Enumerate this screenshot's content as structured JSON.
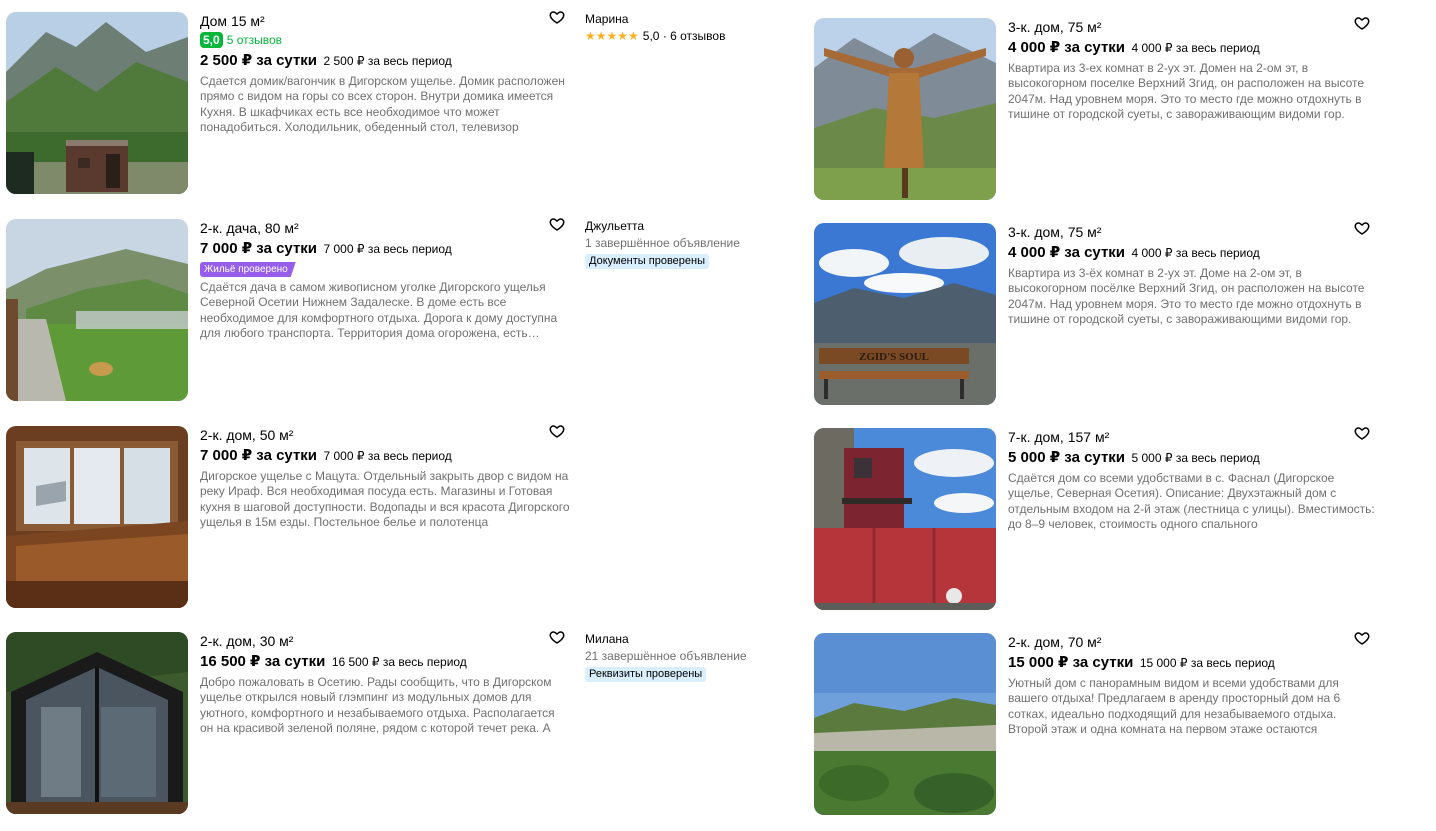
{
  "listings": [
    {
      "title": "Дом 15 м²",
      "rating": "5,0",
      "reviews": "5 отзывов",
      "price_main": "2 500 ₽ за сутки",
      "price_total": "2 500 ₽ за весь период",
      "description": "Сдается домик/вагончик в Дигорском ущелье. Домик расположен прямо с видом на горы со всех сторон. Внутри домика имеется Кухня. В шкафчиках есть все необходимое что может понадобиться. Холодильник, обеденный стол, телевизор",
      "photo": "mountain-valley-cabin"
    },
    {
      "title": "2-к. дача, 80 м²",
      "price_main": "7 000 ₽ за сутки",
      "price_total": "7 000 ₽ за весь период",
      "badge": "Жильё проверено",
      "description": "Сдаётся дача в самом живописном уголке Дигорского ущелья Северной Осетии Нижнем Задалеске. В доме есть все необходимое для комфортного отдыха. Дорога к дому доступна для любого транспорта. Территория дома огорожена, есть парковка",
      "photo": "mountain-garden-path"
    },
    {
      "title": "2-к. дом, 50 м²",
      "price_main": "7 000 ₽ за сутки",
      "price_total": "7 000 ₽ за весь период",
      "description": "Дигорское ущелье с Мацута. Отдельный закрыть двор с видом на реку Ираф. Вся необходимая посуда есть. Магазины и Готовая кухня в шаговой доступности. Водопады и вся красота Дигорского ущелья в 15м езды. Постельное белье и полотенца",
      "photo": "wooden-dining-room"
    },
    {
      "title": "2-к. дом, 30 м²",
      "price_main": "16 500 ₽ за сутки",
      "price_total": "16 500 ₽ за весь период",
      "description": "Добро пожаловать в Осетию. Рады сообщить, что в Дигорском ущелье открылся новый глэмпинг из модульных домов для уютного, комфортного и незабываемого отдыха. Располагается он на красивой зеленой поляне, рядом с которой течет река. А",
      "photo": "glamping-a-frame"
    },
    {
      "title": "3-к. дом, 75 м²",
      "price_main": "4 000 ₽ за сутки",
      "price_total": "4 000 ₽ за весь период",
      "description": "Квартира из 3-ех комнат в 2-ух эт. Домен на 2-ом эт, в высокогорном поселке Верхний Згид, он расположен на высоте 2047м. Над уровнем моря. Это то место где можно отдохнуть в тишине от городской суеты, с завораживающим видоми гор.",
      "photo": "statue-mountains"
    },
    {
      "title": "3-к. дом, 75 м²",
      "price_main": "4 000 ₽ за сутки",
      "price_total": "4 000 ₽ за весь период",
      "description": "Квартира из 3-ёх комнат в 2-ух эт. Доме на 2-ом эт, в высокогорном посёлке Верхний Згид, он расположен на высоте 2047м. Над уровнем моря. Это то место где можно отдохнуть в тишине от городской суеты, с завораживающими видоми гор.",
      "photo": "zgids-soul-bench",
      "bench_text": "ZGID'S SOUL"
    },
    {
      "title": "7-к. дом, 157 м²",
      "price_main": "5 000 ₽ за сутки",
      "price_total": "5 000 ₽ за весь период",
      "description": "Сдаётся дом со всеми удобствами в с. Фаснал (Дигорское ущелье, Северная Осетия). Описание: Двухэтажный дом с отдельным входом на 2-й этаж (лестница с улицы). Вместимость: до 8–9 человек, стоимость одного спального",
      "photo": "red-house-fence"
    },
    {
      "title": "2-к. дом, 70 м²",
      "price_main": "15 000 ₽ за сутки",
      "price_total": "15 000 ₽ за весь период",
      "description": "Уютный дом с панорамным видом и всеми удобствами для вашего отдыха! Предлагаем в аренду просторный дом на 6 сотках, идеально подходящий для незабываемого отдыха. Второй этаж и одна комната на первом этаже остаются",
      "photo": "valley-panorama"
    }
  ],
  "sellers": [
    {
      "name": "Марина",
      "stars": "★★★★★",
      "rating": "5,0 · 6 отзывов"
    },
    {
      "name": "Джульетта",
      "sub": "1 завершённое объявление",
      "badge": "Документы проверены"
    },
    {
      "name": "Милана",
      "sub": "21 завершённое объявление",
      "badge": "Реквизиты проверены"
    }
  ],
  "colors": {
    "rating_green": "#04b73a",
    "verified_purple": "#965eeb",
    "seller_badge_blue": "#d9efff",
    "stars": "#ffb021",
    "muted_text": "#707070"
  },
  "icons": {
    "favorite": "heart-outline-icon"
  }
}
